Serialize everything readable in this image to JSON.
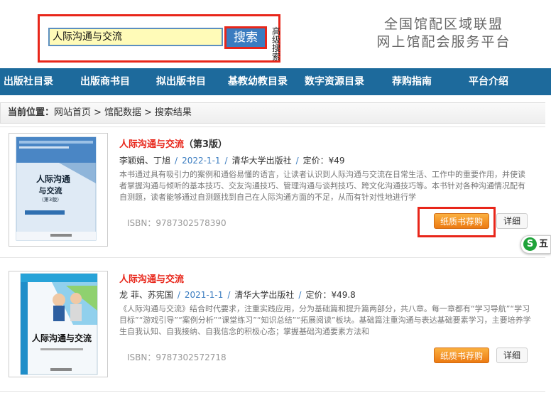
{
  "search": {
    "value": "人际沟通与交流",
    "button": "搜索",
    "advanced": "高级搜索"
  },
  "site_title": {
    "line1": "全国馆配区域联盟",
    "line2": "网上馆配会服务平台"
  },
  "nav": [
    "出版社目录",
    "出版商书目",
    "拟出版书目",
    "基教幼教目录",
    "数字资源目录",
    "荐购指南",
    "平台介绍"
  ],
  "breadcrumb": {
    "label": "当前位置：",
    "items": [
      "网站首页",
      "馆配数据",
      "搜索结果"
    ],
    "sep": ">"
  },
  "results": [
    {
      "title": "人际沟通与交流",
      "edition": "（第3版）",
      "authors": "李颖娟、丁旭",
      "date": "2022-1-1",
      "publisher": "清华大学出版社",
      "price": "定价：¥49",
      "description": "本书通过具有吸引力的案例和通俗易懂的语言，让读者认识到人际沟通与交流在日常生活、工作中的重要作用，并使读者掌握沟通与倾听的基本技巧、交友沟通技巧、管理沟通与谈判技巧、跨文化沟通技巧等。本书针对各种沟通情况配有自测题，读者能够通过自测题找到自己在人际沟通方面的不足，从而有针对性地进行学",
      "isbn": "ISBN：9787302578390",
      "buy": "纸质书荐购",
      "detail": "详细",
      "cover": {
        "title_line1": "人际沟通",
        "title_line2": "与交流",
        "edition": "（第3版）"
      }
    },
    {
      "title": "人际沟通与交流",
      "edition": "",
      "authors": "龙 菲、苏宪国",
      "date": "2021-1-1",
      "publisher": "清华大学出版社",
      "price": "定价：¥49.8",
      "description": "《人际沟通与交流》结合时代要求，注重实践应用，分为基础篇和提升篇两部分，共八章。每一章都有“学习导航”“学习目标”“游戏引导”“案例分析”“课堂练习”“知识总结”“拓展阅读”板块。基础篇注重沟通与表达基础要素学习，主要培养学生自我认知、自我接纳、自我信念的积极心态；掌握基础沟通要素方法和",
      "isbn": "ISBN：9787302572718",
      "buy": "纸质书荐购",
      "detail": "详细",
      "cover": {
        "title": "人际沟通与交流"
      }
    }
  ],
  "ime": {
    "text": "五"
  },
  "colors": {
    "nav": "#1d6a9c",
    "title_red": "#e8261a",
    "link_blue": "#3a7cc0",
    "buy_orange": "#ec7a12"
  }
}
